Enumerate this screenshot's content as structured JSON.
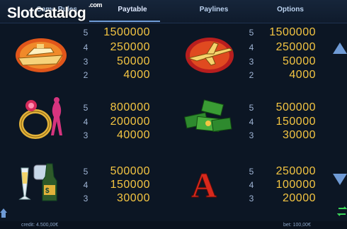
{
  "tabs": [
    {
      "label": "Game Rules"
    },
    {
      "label": "Paytable"
    },
    {
      "label": "Paylines"
    },
    {
      "label": "Options"
    }
  ],
  "logo": {
    "part1": "Slot",
    "part2": "Catalog",
    "suffix": ".com"
  },
  "paytable": [
    {
      "symbol": "yacht",
      "pays": [
        {
          "n": "5",
          "v": "1500000"
        },
        {
          "n": "4",
          "v": "250000"
        },
        {
          "n": "3",
          "v": "50000"
        },
        {
          "n": "2",
          "v": "4000"
        }
      ]
    },
    {
      "symbol": "jet",
      "pays": [
        {
          "n": "5",
          "v": "1500000"
        },
        {
          "n": "4",
          "v": "250000"
        },
        {
          "n": "3",
          "v": "50000"
        },
        {
          "n": "2",
          "v": "4000"
        }
      ]
    },
    {
      "symbol": "ring",
      "pays": [
        {
          "n": "5",
          "v": "800000"
        },
        {
          "n": "4",
          "v": "200000"
        },
        {
          "n": "3",
          "v": "40000"
        }
      ]
    },
    {
      "symbol": "money",
      "pays": [
        {
          "n": "5",
          "v": "500000"
        },
        {
          "n": "4",
          "v": "150000"
        },
        {
          "n": "3",
          "v": "30000"
        }
      ]
    },
    {
      "symbol": "champagne",
      "pays": [
        {
          "n": "5",
          "v": "500000"
        },
        {
          "n": "4",
          "v": "150000"
        },
        {
          "n": "3",
          "v": "30000"
        }
      ]
    },
    {
      "symbol": "ace",
      "pays": [
        {
          "n": "5",
          "v": "250000"
        },
        {
          "n": "4",
          "v": "100000"
        },
        {
          "n": "3",
          "v": "20000"
        }
      ]
    }
  ],
  "footer": {
    "credit": "credit: 4.500,00€",
    "bet": "bet: 100,00€"
  },
  "colors": {
    "background": "#0c1624",
    "payout": "#f4c542",
    "count": "#9fb4d4",
    "accent": "#6f9bd6"
  }
}
